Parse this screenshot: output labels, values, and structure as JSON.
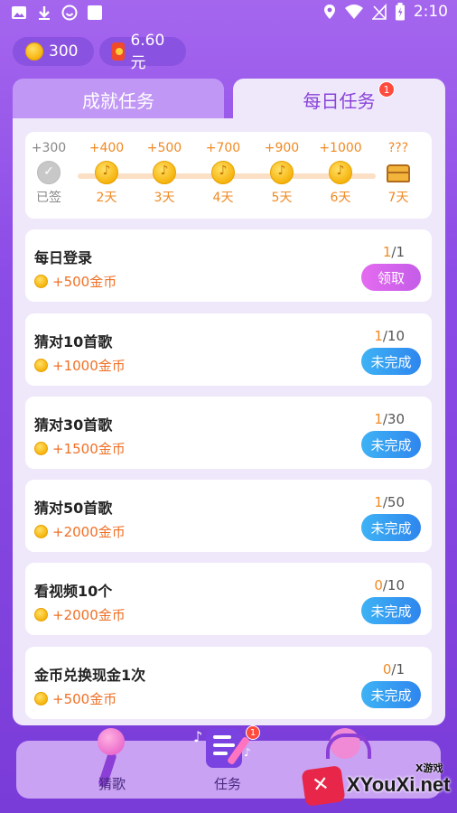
{
  "status_bar": {
    "time": "2:10",
    "left_icons": [
      "image-icon",
      "download-icon",
      "smile-icon",
      "square-icon"
    ],
    "right_icons": [
      "location-icon",
      "wifi-icon",
      "no-signal-icon",
      "battery-icon"
    ]
  },
  "balances": {
    "coins": "300",
    "cash": "6.60元"
  },
  "tabs": [
    {
      "label": "成就任务",
      "active": false
    },
    {
      "label": "每日任务",
      "active": true,
      "badge": "1"
    }
  ],
  "checkin": {
    "days": [
      {
        "reward": "+300",
        "label": "已签",
        "done": true
      },
      {
        "reward": "+400",
        "label": "2天",
        "done": false
      },
      {
        "reward": "+500",
        "label": "3天",
        "done": false
      },
      {
        "reward": "+700",
        "label": "4天",
        "done": false
      },
      {
        "reward": "+900",
        "label": "5天",
        "done": false
      },
      {
        "reward": "+1000",
        "label": "6天",
        "done": false
      },
      {
        "reward": "???",
        "label": "7天",
        "done": false,
        "chest": true
      }
    ]
  },
  "tasks": [
    {
      "title": "每日登录",
      "reward": "+500金币",
      "progress_current": "1",
      "progress_total": "/1",
      "button": "领取",
      "status": "claim"
    },
    {
      "title": "猜对10首歌",
      "reward": "+1000金币",
      "progress_current": "1",
      "progress_total": "/10",
      "button": "未完成",
      "status": "todo"
    },
    {
      "title": "猜对30首歌",
      "reward": "+1500金币",
      "progress_current": "1",
      "progress_total": "/30",
      "button": "未完成",
      "status": "todo"
    },
    {
      "title": "猜对50首歌",
      "reward": "+2000金币",
      "progress_current": "1",
      "progress_total": "/50",
      "button": "未完成",
      "status": "todo"
    },
    {
      "title": "看视频10个",
      "reward": "+2000金币",
      "progress_current": "0",
      "progress_total": "/10",
      "button": "未完成",
      "status": "todo"
    },
    {
      "title": "金币兑换现金1次",
      "reward": "+500金币",
      "progress_current": "0",
      "progress_total": "/1",
      "button": "未完成",
      "status": "todo"
    }
  ],
  "bottom_nav": [
    {
      "label": "猜歌",
      "icon": "microphone-icon"
    },
    {
      "label": "任务",
      "icon": "task-list-icon",
      "badge": "1"
    },
    {
      "label": "",
      "icon": "headphone-avatar-icon"
    }
  ],
  "watermark": {
    "text": "XYouXi.net",
    "small": "X游戏"
  },
  "colors": {
    "accent_purple": "#8a43d9",
    "claim_pink": "#e46bf0",
    "todo_blue": "#2f86ee",
    "reward_orange": "#f07026"
  }
}
